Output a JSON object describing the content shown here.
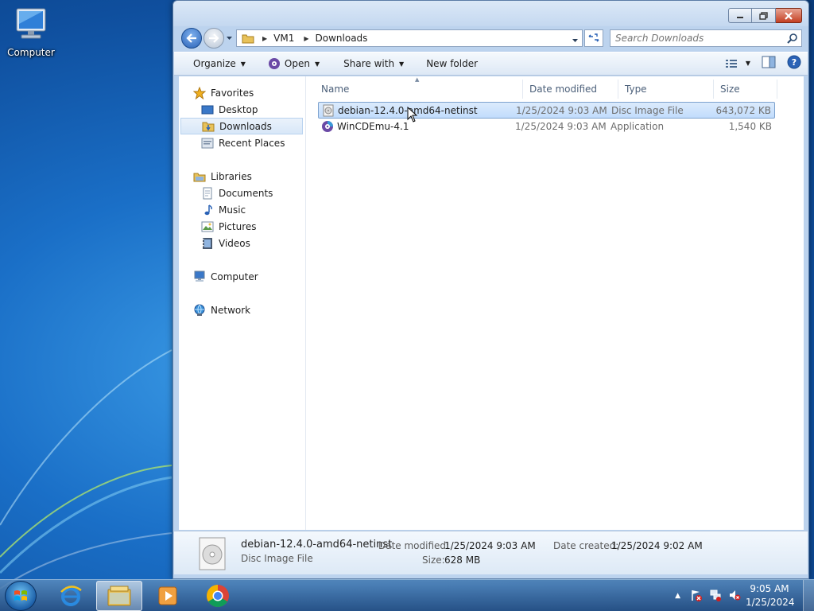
{
  "desktop": {
    "icon_label": "Computer"
  },
  "window": {
    "address": {
      "crumbs": [
        "VM1",
        "Downloads"
      ]
    },
    "search": {
      "placeholder": "Search Downloads"
    },
    "toolbar": {
      "organize": "Organize",
      "open": "Open",
      "share_with": "Share with",
      "new_folder": "New folder"
    },
    "nav": {
      "favorites": "Favorites",
      "desktop": "Desktop",
      "downloads": "Downloads",
      "recent_places": "Recent Places",
      "libraries": "Libraries",
      "documents": "Documents",
      "music": "Music",
      "pictures": "Pictures",
      "videos": "Videos",
      "computer": "Computer",
      "network": "Network"
    },
    "columns": {
      "name": "Name",
      "date_modified": "Date modified",
      "type": "Type",
      "size": "Size"
    },
    "files": [
      {
        "name": "debian-12.4.0-amd64-netinst",
        "date": "1/25/2024 9:03 AM",
        "type": "Disc Image File",
        "size": "643,072 KB"
      },
      {
        "name": "WinCDEmu-4.1",
        "date": "1/25/2024 9:03 AM",
        "type": "Application",
        "size": "1,540 KB"
      }
    ],
    "details": {
      "name": "debian-12.4.0-amd64-netinst",
      "type": "Disc Image File",
      "date_modified_label": "Date modified:",
      "date_modified": "1/25/2024 9:03 AM",
      "date_created_label": "Date created:",
      "date_created": "1/25/2024 9:02 AM",
      "size_label": "Size:",
      "size": "628 MB"
    }
  },
  "taskbar": {
    "time": "9:05 AM",
    "date": "1/25/2024"
  },
  "colors": {
    "accent": "#2a62b6",
    "selection": "#c1dcfc",
    "close": "#c43f22"
  }
}
